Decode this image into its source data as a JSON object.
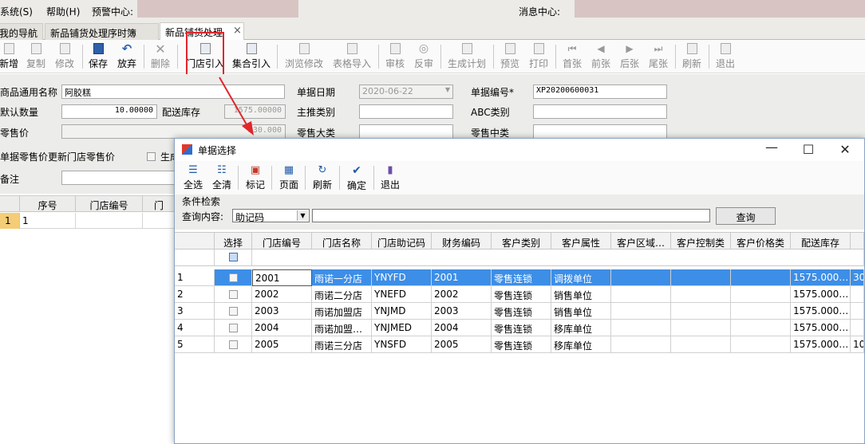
{
  "menubar": {
    "items": [
      "系统(S)",
      "帮助(H)",
      "预警中心:"
    ],
    "message_center": "消息中心:"
  },
  "tabs": [
    {
      "label": "我的导航"
    },
    {
      "label": "新品铺货处理序时簿"
    },
    {
      "label": "新品铺货处理",
      "close": "×"
    }
  ],
  "toolbar": {
    "buttons": [
      "新增",
      "复制",
      "修改",
      "保存",
      "放弃",
      "删除",
      "门店引入",
      "集合引入",
      "浏览修改",
      "表格导入",
      "审核",
      "反审",
      "生成计划",
      "预览",
      "打印",
      "首张",
      "前张",
      "后张",
      "尾张",
      "刷新",
      "退出"
    ]
  },
  "form": {
    "product_name_label": "商品通用名称",
    "product_name_value": "阿胶糕",
    "bill_date_label": "单据日期",
    "bill_date_value": "2020-06-22",
    "bill_no_label": "单据编号*",
    "bill_no_value": "XP20200600031",
    "default_qty_label": "默认数量",
    "default_qty_value": "10.00000",
    "dist_stock_label": "配送库存",
    "dist_stock_value": "1575.00000",
    "main_category_label": "主推类别",
    "abc_label": "ABC类别",
    "retail_price_label": "零售价",
    "retail_price_value": "330.000",
    "retail_major_label": "零售大类",
    "retail_mid_label": "零售中类",
    "update_price_label": "单据零售价更新门店零售价",
    "checkbox_label": "生成",
    "remark_label": "备注"
  },
  "left_grid": {
    "headers": [
      "序号",
      "门店编号",
      "门"
    ],
    "row_num": "1",
    "row_value": "1"
  },
  "dialog": {
    "title": "单据选择",
    "toolbar": [
      "全选",
      "全清",
      "标记",
      "页面",
      "刷新",
      "确定",
      "退出"
    ],
    "cond_group": "条件检索",
    "query_label": "查询内容:",
    "query_field": "助记码",
    "query_value": "",
    "query_button": "查询",
    "headers": [
      "选择",
      "门店编号",
      "门店名称",
      "门店助记码",
      "财务编码",
      "客户类别",
      "客户属性",
      "客户区域…",
      "客户控制类",
      "客户价格类",
      "配送库存"
    ],
    "rows": [
      {
        "n": "1",
        "code": "2001",
        "name": "雨诺一分店",
        "mnemonic": "YNYFD",
        "fin": "2001",
        "type": "零售连锁",
        "attr": "调拨单位",
        "stock": "1575.000…",
        "extra": "30"
      },
      {
        "n": "2",
        "code": "2002",
        "name": "雨诺二分店",
        "mnemonic": "YNEFD",
        "fin": "2002",
        "type": "零售连锁",
        "attr": "销售单位",
        "stock": "1575.000…",
        "extra": ""
      },
      {
        "n": "3",
        "code": "2003",
        "name": "雨诺加盟店",
        "mnemonic": "YNJMD",
        "fin": "2003",
        "type": "零售连锁",
        "attr": "销售单位",
        "stock": "1575.000…",
        "extra": ""
      },
      {
        "n": "4",
        "code": "2004",
        "name": "雨诺加盟…",
        "mnemonic": "YNJMED",
        "fin": "2004",
        "type": "零售连锁",
        "attr": "移库单位",
        "stock": "1575.000…",
        "extra": ""
      },
      {
        "n": "5",
        "code": "2005",
        "name": "雨诺三分店",
        "mnemonic": "YNSFD",
        "fin": "2005",
        "type": "零售连锁",
        "attr": "移库单位",
        "stock": "1575.000…",
        "extra": "10"
      }
    ]
  },
  "colors": {
    "highlight": "#e1262b",
    "selection": "#3d8ee6",
    "row_marker": "#f5cd77"
  }
}
